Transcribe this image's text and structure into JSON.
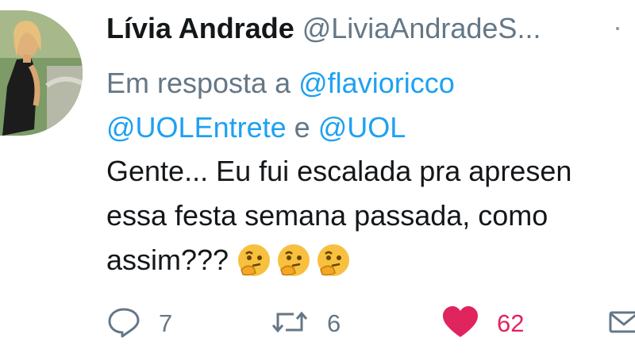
{
  "author": {
    "name": "Lívia Andrade",
    "handle": "@LiviaAndradeS...",
    "avatar_icon": "profile-photo"
  },
  "reply": {
    "prefix": "Em resposta a",
    "mention1": "@flavioricco",
    "mention2": "@UOLEntrete",
    "conjunction": "e",
    "mention3": "@UOL"
  },
  "tweet": {
    "line1": "Gente... Eu fui escalada pra apresen",
    "line2": "essa festa semana passada, como",
    "line3": "assim???",
    "emojis": [
      "thinking-face",
      "thinking-face",
      "thinking-face"
    ]
  },
  "actions": {
    "reply_count": "7",
    "retweet_count": "6",
    "like_count": "62",
    "like_color": "#e0245e"
  }
}
